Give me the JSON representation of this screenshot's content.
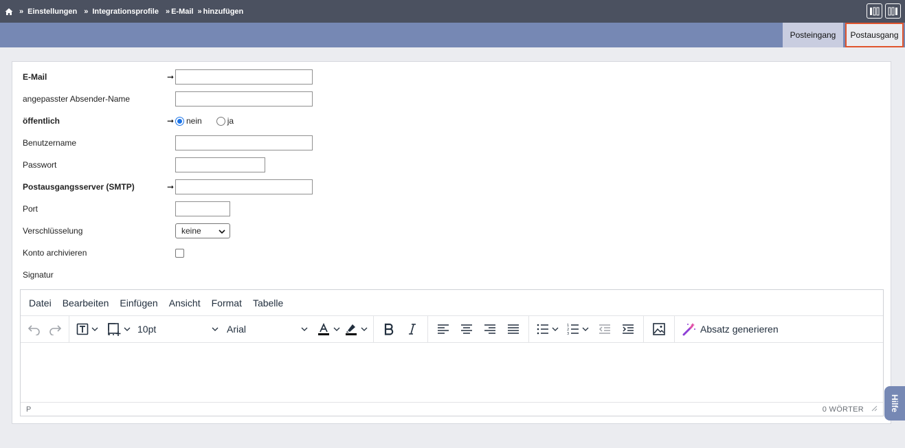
{
  "breadcrumb": {
    "home_sep": "»",
    "items": [
      "Einstellungen",
      "Integrationsprofile",
      "E-Mail",
      "hinzufügen"
    ],
    "sep": "»"
  },
  "tabs": {
    "inbox": "Posteingang",
    "outbox": "Postausgang"
  },
  "form": {
    "email_label": "E-Mail",
    "sender_label": "angepasster Absender-Name",
    "public_label": "öffentlich",
    "public_no": "nein",
    "public_yes": "ja",
    "public_selected": "nein",
    "username_label": "Benutzername",
    "password_label": "Passwort",
    "smtp_label": "Postausgangsserver (SMTP)",
    "port_label": "Port",
    "encryption_label": "Verschlüsselung",
    "encryption_value": "keine",
    "archive_label": "Konto archivieren",
    "signature_label": "Signatur",
    "arrow": "➞"
  },
  "editor": {
    "menu": [
      "Datei",
      "Bearbeiten",
      "Einfügen",
      "Ansicht",
      "Format",
      "Tabelle"
    ],
    "font_size": "10pt",
    "font_family": "Arial",
    "generate_label": "Absatz generieren",
    "status_path": "P",
    "word_count": "0 WÖRTER"
  },
  "help": {
    "label": "Hilfe"
  },
  "colors": {
    "topbar": "#4b5160",
    "tabbar": "#7688b4",
    "active_tab_border": "#e0542d",
    "radio_accent": "#1a73e8"
  }
}
